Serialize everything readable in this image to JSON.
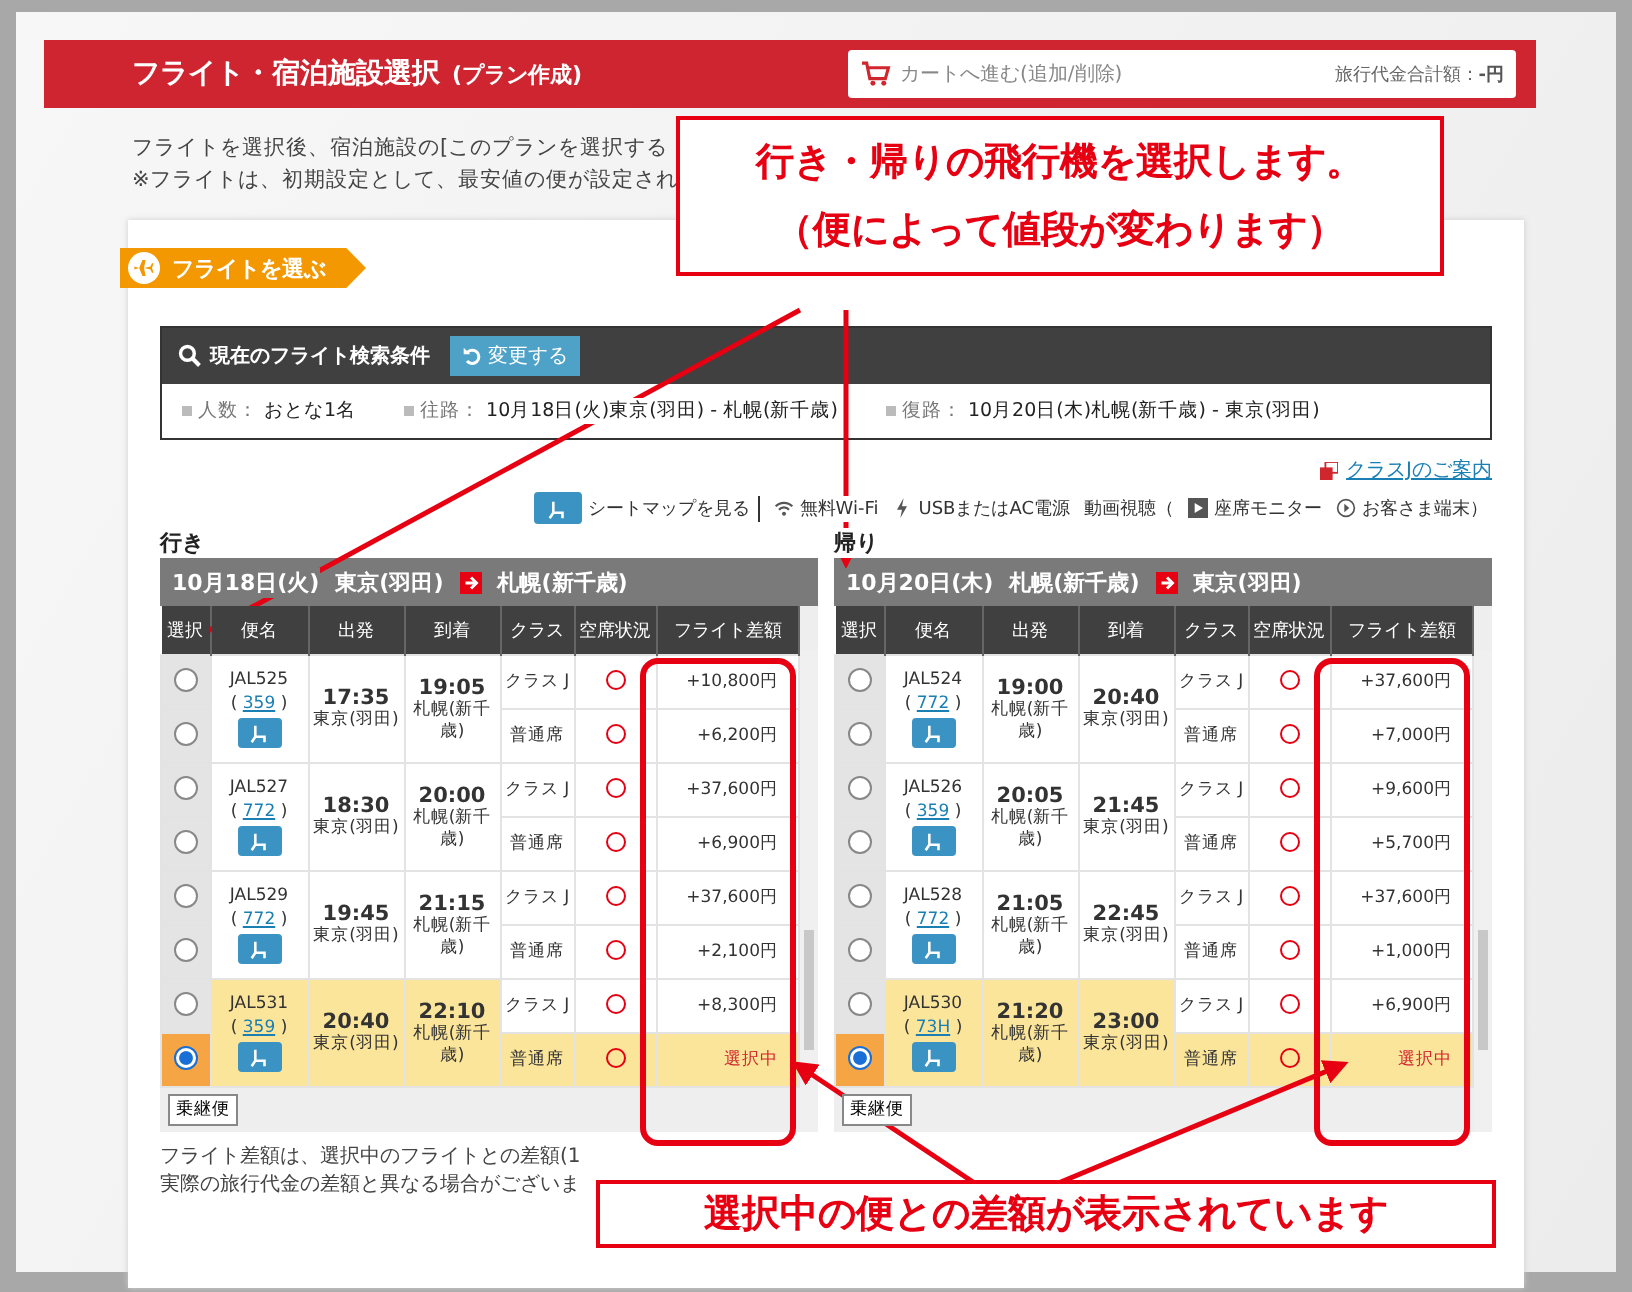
{
  "header": {
    "title": "フライト・宿泊施設選択",
    "subtitle": "(プラン作成)",
    "cart_link": "カートへ進む(追加/削除)",
    "total_label": "旅行代金合計額：",
    "total_value": "-円"
  },
  "intro": [
    "フライトを選択後、宿泊施設の[このプランを選択する",
    "※フライトは、初期設定として、最安値の便が設定され"
  ],
  "section_tab": "フライトを選ぶ",
  "search": {
    "title": "現在のフライト検索条件",
    "change_button": "変更する",
    "conditions": [
      {
        "label": "人数：",
        "value": "おとな1名"
      },
      {
        "label": "往路：",
        "value": "10月18日(火)東京(羽田) - 札幌(新千歳)"
      },
      {
        "label": "復路：",
        "value": "10月20日(木)札幌(新千歳) - 東京(羽田)"
      }
    ]
  },
  "class_link": "クラスJのご案内",
  "legend": [
    {
      "kind": "seat",
      "label": "シートマップを見る"
    },
    {
      "kind": "wifi",
      "label": "無料Wi-Fi"
    },
    {
      "kind": "power",
      "label": "USBまたはAC電源"
    },
    {
      "kind": "text",
      "label": "動画視聴（"
    },
    {
      "kind": "monitor",
      "label": "座席モニター"
    },
    {
      "kind": "play",
      "label": "お客さま端末）"
    }
  ],
  "panels": [
    {
      "label": "行き",
      "date": "10月18日(火)",
      "from": "東京(羽田)",
      "to": "札幌(新千歳)",
      "columns": [
        "選択",
        "便名",
        "出発",
        "到着",
        "クラス",
        "空席状況",
        "フライト差額"
      ],
      "connecting_button": "乗継便",
      "flights": [
        {
          "number": "JAL525",
          "paren_open": "(",
          "aircraft": "359",
          "paren_close": ")",
          "dep_time": "17:35",
          "dep_place": "東京(羽田)",
          "arr_time": "19:05",
          "arr_place": "札幌(新千歳)",
          "classes": [
            {
              "name": "クラス J",
              "diff": "+10,800円",
              "selected": false
            },
            {
              "name": "普通席",
              "diff": "+6,200円",
              "selected": false
            }
          ]
        },
        {
          "number": "JAL527",
          "paren_open": "(",
          "aircraft": "772",
          "paren_close": ")",
          "dep_time": "18:30",
          "dep_place": "東京(羽田)",
          "arr_time": "20:00",
          "arr_place": "札幌(新千歳)",
          "classes": [
            {
              "name": "クラス J",
              "diff": "+37,600円",
              "selected": false
            },
            {
              "name": "普通席",
              "diff": "+6,900円",
              "selected": false
            }
          ]
        },
        {
          "number": "JAL529",
          "paren_open": "(",
          "aircraft": "772",
          "paren_close": ")",
          "dep_time": "19:45",
          "dep_place": "東京(羽田)",
          "arr_time": "21:15",
          "arr_place": "札幌(新千歳)",
          "classes": [
            {
              "name": "クラス J",
              "diff": "+37,600円",
              "selected": false
            },
            {
              "name": "普通席",
              "diff": "+2,100円",
              "selected": false
            }
          ]
        },
        {
          "number": "JAL531",
          "paren_open": "(",
          "aircraft": "359",
          "paren_close": ")",
          "dep_time": "20:40",
          "dep_place": "東京(羽田)",
          "arr_time": "22:10",
          "arr_place": "札幌(新千歳)",
          "classes": [
            {
              "name": "クラス J",
              "diff": "+8,300円",
              "selected": false
            },
            {
              "name": "普通席",
              "diff": "選択中",
              "selected": true
            }
          ]
        }
      ]
    },
    {
      "label": "帰り",
      "date": "10月20日(木)",
      "from": "札幌(新千歳)",
      "to": "東京(羽田)",
      "columns": [
        "選択",
        "便名",
        "出発",
        "到着",
        "クラス",
        "空席状況",
        "フライト差額"
      ],
      "connecting_button": "乗継便",
      "flights": [
        {
          "number": "JAL524",
          "paren_open": "(",
          "aircraft": "772",
          "paren_close": ")",
          "dep_time": "19:00",
          "dep_place": "札幌(新千歳)",
          "arr_time": "20:40",
          "arr_place": "東京(羽田)",
          "classes": [
            {
              "name": "クラス J",
              "diff": "+37,600円",
              "selected": false
            },
            {
              "name": "普通席",
              "diff": "+7,000円",
              "selected": false
            }
          ]
        },
        {
          "number": "JAL526",
          "paren_open": "(",
          "aircraft": "359",
          "paren_close": ")",
          "dep_time": "20:05",
          "dep_place": "札幌(新千歳)",
          "arr_time": "21:45",
          "arr_place": "東京(羽田)",
          "classes": [
            {
              "name": "クラス J",
              "diff": "+9,600円",
              "selected": false
            },
            {
              "name": "普通席",
              "diff": "+5,700円",
              "selected": false
            }
          ]
        },
        {
          "number": "JAL528",
          "paren_open": "(",
          "aircraft": "772",
          "paren_close": ")",
          "dep_time": "21:05",
          "dep_place": "札幌(新千歳)",
          "arr_time": "22:45",
          "arr_place": "東京(羽田)",
          "classes": [
            {
              "name": "クラス J",
              "diff": "+37,600円",
              "selected": false
            },
            {
              "name": "普通席",
              "diff": "+1,000円",
              "selected": false
            }
          ]
        },
        {
          "number": "JAL530",
          "paren_open": "(",
          "aircraft": "73H",
          "paren_close": ")",
          "dep_time": "21:20",
          "dep_place": "札幌(新千歳)",
          "arr_time": "23:00",
          "arr_place": "東京(羽田)",
          "classes": [
            {
              "name": "クラス J",
              "diff": "+6,900円",
              "selected": false
            },
            {
              "name": "普通席",
              "diff": "選択中",
              "selected": true
            }
          ]
        }
      ]
    }
  ],
  "notes": [
    "フライト差額は、選択中のフライトとの差額(1",
    "実際の旅行代金の差額と異なる場合がございま"
  ],
  "callouts": [
    {
      "lines": [
        "行き・帰りの飛行機を選択します。",
        "（便によって値段が変わります）"
      ]
    },
    {
      "lines": [
        "選択中の便との差額が表示されています"
      ]
    }
  ]
}
